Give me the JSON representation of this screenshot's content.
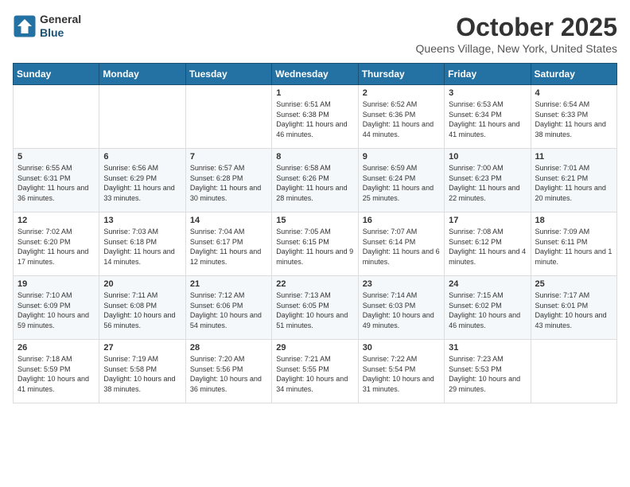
{
  "header": {
    "logo_general": "General",
    "logo_blue": "Blue",
    "month_title": "October 2025",
    "location": "Queens Village, New York, United States"
  },
  "weekdays": [
    "Sunday",
    "Monday",
    "Tuesday",
    "Wednesday",
    "Thursday",
    "Friday",
    "Saturday"
  ],
  "weeks": [
    [
      {
        "day": "",
        "sunrise": "",
        "sunset": "",
        "daylight": ""
      },
      {
        "day": "",
        "sunrise": "",
        "sunset": "",
        "daylight": ""
      },
      {
        "day": "",
        "sunrise": "",
        "sunset": "",
        "daylight": ""
      },
      {
        "day": "1",
        "sunrise": "Sunrise: 6:51 AM",
        "sunset": "Sunset: 6:38 PM",
        "daylight": "Daylight: 11 hours and 46 minutes."
      },
      {
        "day": "2",
        "sunrise": "Sunrise: 6:52 AM",
        "sunset": "Sunset: 6:36 PM",
        "daylight": "Daylight: 11 hours and 44 minutes."
      },
      {
        "day": "3",
        "sunrise": "Sunrise: 6:53 AM",
        "sunset": "Sunset: 6:34 PM",
        "daylight": "Daylight: 11 hours and 41 minutes."
      },
      {
        "day": "4",
        "sunrise": "Sunrise: 6:54 AM",
        "sunset": "Sunset: 6:33 PM",
        "daylight": "Daylight: 11 hours and 38 minutes."
      }
    ],
    [
      {
        "day": "5",
        "sunrise": "Sunrise: 6:55 AM",
        "sunset": "Sunset: 6:31 PM",
        "daylight": "Daylight: 11 hours and 36 minutes."
      },
      {
        "day": "6",
        "sunrise": "Sunrise: 6:56 AM",
        "sunset": "Sunset: 6:29 PM",
        "daylight": "Daylight: 11 hours and 33 minutes."
      },
      {
        "day": "7",
        "sunrise": "Sunrise: 6:57 AM",
        "sunset": "Sunset: 6:28 PM",
        "daylight": "Daylight: 11 hours and 30 minutes."
      },
      {
        "day": "8",
        "sunrise": "Sunrise: 6:58 AM",
        "sunset": "Sunset: 6:26 PM",
        "daylight": "Daylight: 11 hours and 28 minutes."
      },
      {
        "day": "9",
        "sunrise": "Sunrise: 6:59 AM",
        "sunset": "Sunset: 6:24 PM",
        "daylight": "Daylight: 11 hours and 25 minutes."
      },
      {
        "day": "10",
        "sunrise": "Sunrise: 7:00 AM",
        "sunset": "Sunset: 6:23 PM",
        "daylight": "Daylight: 11 hours and 22 minutes."
      },
      {
        "day": "11",
        "sunrise": "Sunrise: 7:01 AM",
        "sunset": "Sunset: 6:21 PM",
        "daylight": "Daylight: 11 hours and 20 minutes."
      }
    ],
    [
      {
        "day": "12",
        "sunrise": "Sunrise: 7:02 AM",
        "sunset": "Sunset: 6:20 PM",
        "daylight": "Daylight: 11 hours and 17 minutes."
      },
      {
        "day": "13",
        "sunrise": "Sunrise: 7:03 AM",
        "sunset": "Sunset: 6:18 PM",
        "daylight": "Daylight: 11 hours and 14 minutes."
      },
      {
        "day": "14",
        "sunrise": "Sunrise: 7:04 AM",
        "sunset": "Sunset: 6:17 PM",
        "daylight": "Daylight: 11 hours and 12 minutes."
      },
      {
        "day": "15",
        "sunrise": "Sunrise: 7:05 AM",
        "sunset": "Sunset: 6:15 PM",
        "daylight": "Daylight: 11 hours and 9 minutes."
      },
      {
        "day": "16",
        "sunrise": "Sunrise: 7:07 AM",
        "sunset": "Sunset: 6:14 PM",
        "daylight": "Daylight: 11 hours and 6 minutes."
      },
      {
        "day": "17",
        "sunrise": "Sunrise: 7:08 AM",
        "sunset": "Sunset: 6:12 PM",
        "daylight": "Daylight: 11 hours and 4 minutes."
      },
      {
        "day": "18",
        "sunrise": "Sunrise: 7:09 AM",
        "sunset": "Sunset: 6:11 PM",
        "daylight": "Daylight: 11 hours and 1 minute."
      }
    ],
    [
      {
        "day": "19",
        "sunrise": "Sunrise: 7:10 AM",
        "sunset": "Sunset: 6:09 PM",
        "daylight": "Daylight: 10 hours and 59 minutes."
      },
      {
        "day": "20",
        "sunrise": "Sunrise: 7:11 AM",
        "sunset": "Sunset: 6:08 PM",
        "daylight": "Daylight: 10 hours and 56 minutes."
      },
      {
        "day": "21",
        "sunrise": "Sunrise: 7:12 AM",
        "sunset": "Sunset: 6:06 PM",
        "daylight": "Daylight: 10 hours and 54 minutes."
      },
      {
        "day": "22",
        "sunrise": "Sunrise: 7:13 AM",
        "sunset": "Sunset: 6:05 PM",
        "daylight": "Daylight: 10 hours and 51 minutes."
      },
      {
        "day": "23",
        "sunrise": "Sunrise: 7:14 AM",
        "sunset": "Sunset: 6:03 PM",
        "daylight": "Daylight: 10 hours and 49 minutes."
      },
      {
        "day": "24",
        "sunrise": "Sunrise: 7:15 AM",
        "sunset": "Sunset: 6:02 PM",
        "daylight": "Daylight: 10 hours and 46 minutes."
      },
      {
        "day": "25",
        "sunrise": "Sunrise: 7:17 AM",
        "sunset": "Sunset: 6:01 PM",
        "daylight": "Daylight: 10 hours and 43 minutes."
      }
    ],
    [
      {
        "day": "26",
        "sunrise": "Sunrise: 7:18 AM",
        "sunset": "Sunset: 5:59 PM",
        "daylight": "Daylight: 10 hours and 41 minutes."
      },
      {
        "day": "27",
        "sunrise": "Sunrise: 7:19 AM",
        "sunset": "Sunset: 5:58 PM",
        "daylight": "Daylight: 10 hours and 38 minutes."
      },
      {
        "day": "28",
        "sunrise": "Sunrise: 7:20 AM",
        "sunset": "Sunset: 5:56 PM",
        "daylight": "Daylight: 10 hours and 36 minutes."
      },
      {
        "day": "29",
        "sunrise": "Sunrise: 7:21 AM",
        "sunset": "Sunset: 5:55 PM",
        "daylight": "Daylight: 10 hours and 34 minutes."
      },
      {
        "day": "30",
        "sunrise": "Sunrise: 7:22 AM",
        "sunset": "Sunset: 5:54 PM",
        "daylight": "Daylight: 10 hours and 31 minutes."
      },
      {
        "day": "31",
        "sunrise": "Sunrise: 7:23 AM",
        "sunset": "Sunset: 5:53 PM",
        "daylight": "Daylight: 10 hours and 29 minutes."
      },
      {
        "day": "",
        "sunrise": "",
        "sunset": "",
        "daylight": ""
      }
    ]
  ]
}
